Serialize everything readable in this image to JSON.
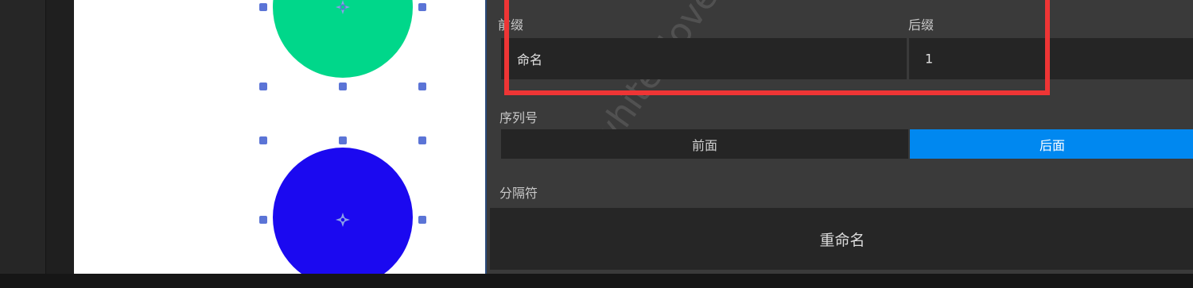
{
  "colors": {
    "accent": "#0088f0",
    "highlight_box": "#ee3535",
    "shape_green": "#00d78a",
    "shape_blue": "#1b09f0",
    "handle": "#5b74d6"
  },
  "canvas": {
    "shapes": [
      {
        "name": "green-circle",
        "color": "#00d78a"
      },
      {
        "name": "blue-circle",
        "color": "#1b09f0"
      }
    ]
  },
  "panel": {
    "prefix_label": "前缀",
    "suffix_label": "后缀",
    "prefix_value": "命名",
    "suffix_value": "1",
    "sequence_label": "序列号",
    "sequence_options": [
      "前面",
      "后面"
    ],
    "sequence_selected": "后面",
    "separator_label": "分隔符",
    "rename_button": "重命名",
    "watermark": "white dove"
  }
}
